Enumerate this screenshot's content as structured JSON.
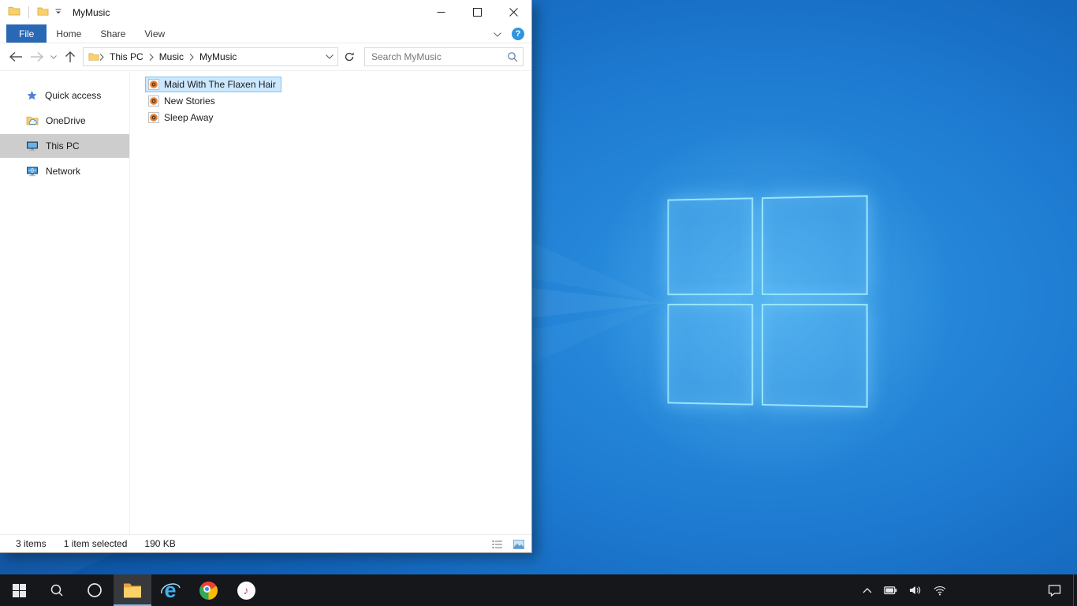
{
  "desktop": {
    "wallpaper": {
      "base_color": "#1470c8",
      "logo_glow_color": "#7fdcff"
    }
  },
  "explorer": {
    "window_title": "MyMusic",
    "titlebar": {
      "quick_access_icons": [
        "folder-icon",
        "folder-icon",
        "customize-chevron-icon"
      ],
      "control_icons": [
        "minimize-icon",
        "maximize-icon",
        "close-icon"
      ]
    },
    "ribbon": {
      "tabs": [
        {
          "label": "File",
          "active": true
        },
        {
          "label": "Home",
          "active": false
        },
        {
          "label": "Share",
          "active": false
        },
        {
          "label": "View",
          "active": false
        }
      ],
      "file_tab_color": "#2968b4",
      "expand_icon": "chevron-down-icon",
      "help_glyph": "?"
    },
    "address_bar": {
      "nav_icons": [
        "back-icon",
        "forward-icon",
        "recent-chevron-icon",
        "up-icon"
      ],
      "location_icon": "folder-icon",
      "breadcrumbs": [
        {
          "label": "This PC"
        },
        {
          "label": "Music"
        },
        {
          "label": "MyMusic"
        }
      ],
      "dropdown_icon": "chevron-down-icon",
      "refresh_icon": "refresh-icon",
      "search_placeholder": "Search MyMusic",
      "search_icon": "search-icon"
    },
    "sidebar": [
      {
        "label": "Quick access",
        "icon": "star-icon",
        "selected": false
      },
      {
        "label": "OneDrive",
        "icon": "onedrive-folder-icon",
        "selected": false
      },
      {
        "label": "This PC",
        "icon": "computer-icon",
        "selected": true
      },
      {
        "label": "Network",
        "icon": "network-icon",
        "selected": false
      }
    ],
    "files": [
      {
        "name": "Maid With The Flaxen Hair",
        "icon": "music-file-icon",
        "selected": true
      },
      {
        "name": "New Stories",
        "icon": "music-file-icon",
        "selected": false
      },
      {
        "name": "Sleep Away",
        "icon": "music-file-icon",
        "selected": false
      }
    ],
    "status_bar": {
      "items_count": "3 items",
      "selection_summary": "1 item selected",
      "selection_size": "190 KB",
      "view_button_icons": [
        "details-view-icon",
        "thumbnail-view-icon"
      ]
    },
    "selection_colors": {
      "file_selected_background": "#cce8ff",
      "file_selected_border": "#84c4f0",
      "sidebar_selected_background": "#cdcdcd"
    }
  },
  "taskbar": {
    "background_color": "#15171b",
    "active_underline_color": "#76b9ed",
    "buttons": [
      {
        "name": "start",
        "active": false
      },
      {
        "name": "search",
        "active": false
      },
      {
        "name": "cortana",
        "active": false
      },
      {
        "name": "file-explorer",
        "active": true
      },
      {
        "name": "internet-explorer",
        "active": false,
        "glyph": "e"
      },
      {
        "name": "chrome",
        "active": false
      },
      {
        "name": "itunes",
        "active": false,
        "glyph": "♪"
      }
    ],
    "tray_icons": [
      "chevron-up-icon",
      "battery-icon",
      "volume-icon",
      "wifi-icon"
    ],
    "action_center_icon": "action-center-icon"
  }
}
